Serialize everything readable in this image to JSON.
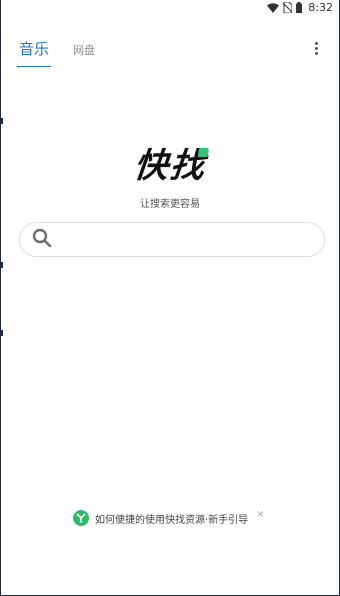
{
  "status_bar": {
    "time": "8:32",
    "icons": [
      "wifi-icon",
      "no-sim-icon",
      "battery-icon"
    ]
  },
  "tabs": [
    {
      "label": "音乐",
      "active": true
    },
    {
      "label": "网盘",
      "active": false
    }
  ],
  "header": {
    "more_icon": "more-vert-icon"
  },
  "logo": {
    "text": "快找"
  },
  "slogan": "让搜索更容易",
  "search": {
    "placeholder": "",
    "value": "",
    "icon": "search-icon"
  },
  "guide": {
    "text": "如何便捷的使用快找资源·新手引导",
    "close": "×",
    "icon": "logo-badge-icon"
  },
  "colors": {
    "accent": "#1f74d1",
    "brand_green": "#37c37a",
    "text_dark": "#111111",
    "muted": "#8a8a8a"
  }
}
